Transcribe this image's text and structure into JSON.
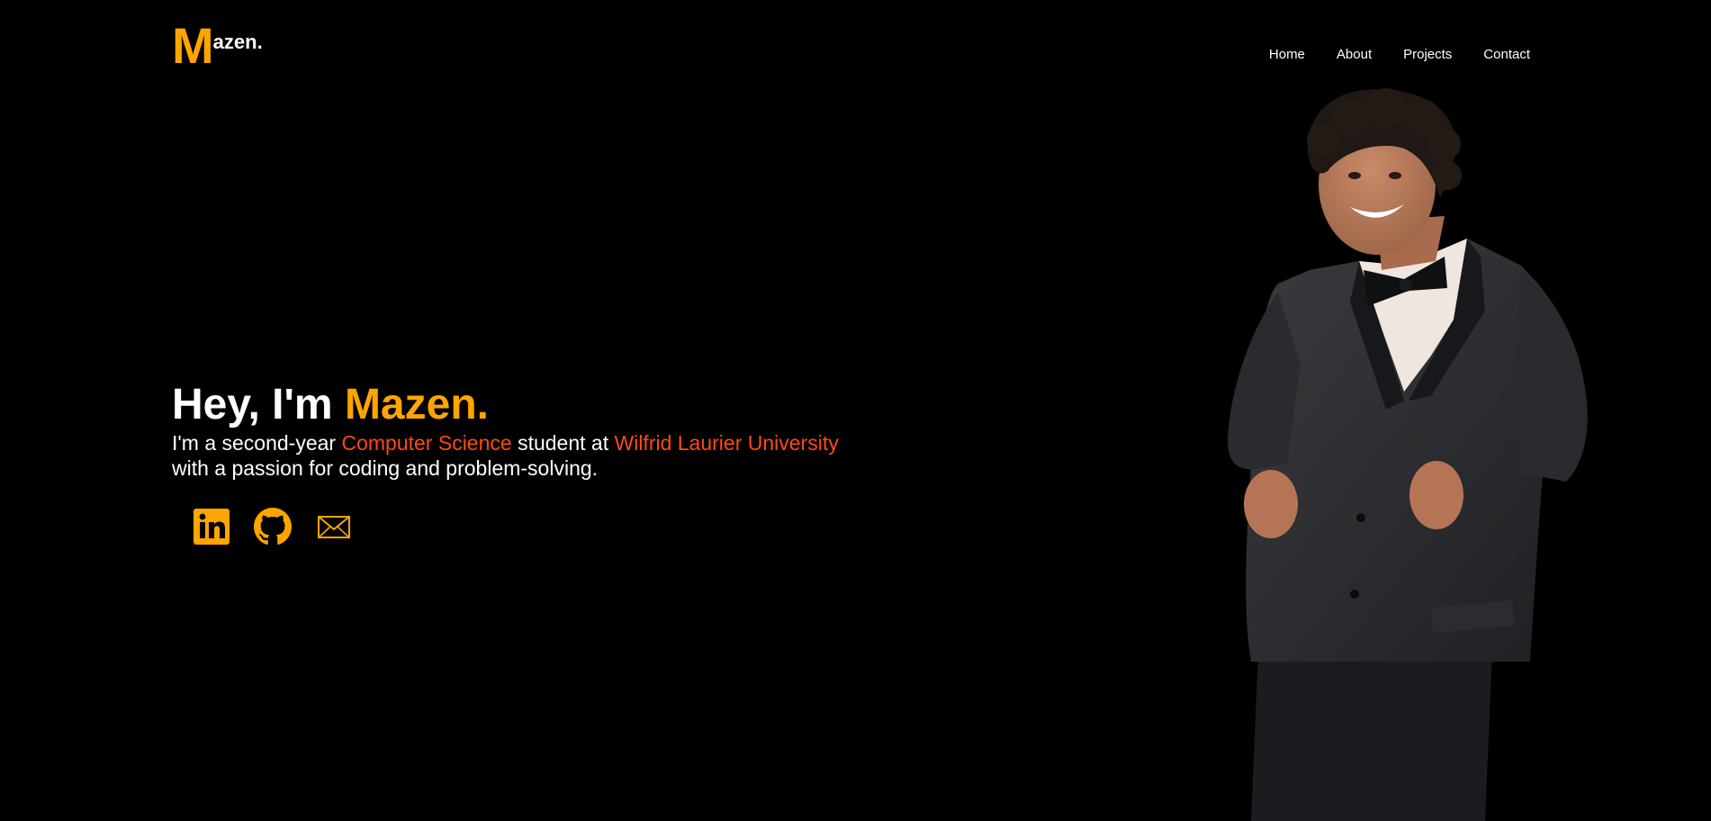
{
  "colors": {
    "background": "#000000",
    "accent_orange": "#ffa500",
    "highlight_red": "#ff4a0f",
    "text": "#ffffff"
  },
  "logo": {
    "initial": "M",
    "rest": "azen."
  },
  "nav": {
    "items": [
      {
        "label": "Home"
      },
      {
        "label": "About"
      },
      {
        "label": "Projects"
      },
      {
        "label": "Contact"
      }
    ]
  },
  "hero": {
    "greeting_prefix": "Hey, I'm ",
    "name": "Mazen.",
    "line1_part1": "I'm a second-year ",
    "line1_major": "Computer Science",
    "line1_part2": " student at ",
    "line1_school": "Wilfrid Laurier University",
    "line2": "with a passion for coding and problem-solving."
  },
  "socials": [
    {
      "icon": "linkedin-icon"
    },
    {
      "icon": "github-icon"
    },
    {
      "icon": "email-icon"
    }
  ],
  "portrait": {
    "icon": "portrait-photo"
  }
}
